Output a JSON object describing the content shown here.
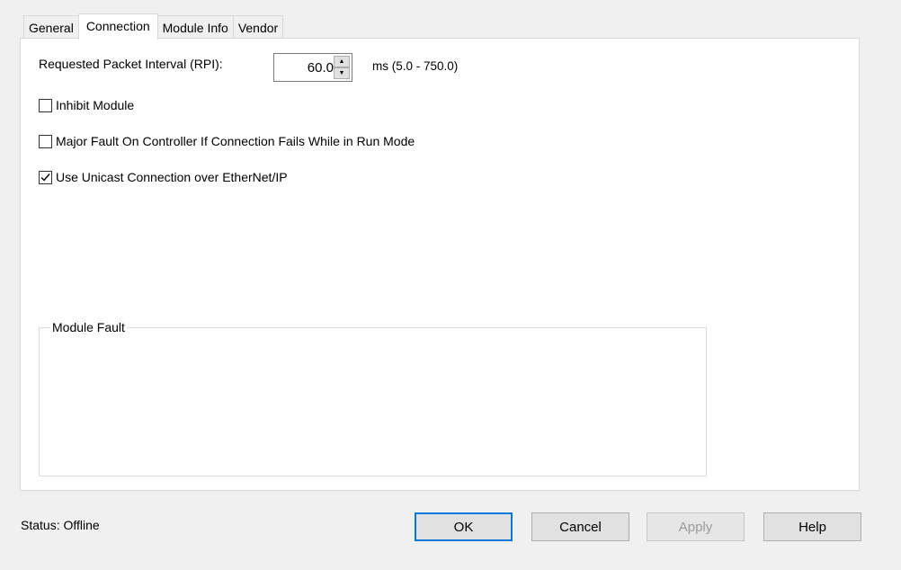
{
  "tabs": [
    {
      "label": "General",
      "active": false
    },
    {
      "label": "Connection",
      "active": true
    },
    {
      "label": "Module Info",
      "active": false
    },
    {
      "label": "Vendor",
      "active": false
    }
  ],
  "rpi": {
    "label": "Requested Packet Interval (RPI):",
    "value": "60.0",
    "range": "ms (5.0 - 750.0)"
  },
  "options": {
    "inhibit": {
      "label": "Inhibit Module",
      "checked": false
    },
    "major_fault": {
      "label": "Major Fault On Controller If Connection Fails While in Run Mode",
      "checked": false
    },
    "unicast": {
      "label": "Use Unicast Connection over EtherNet/IP",
      "checked": true
    }
  },
  "module_fault": {
    "title": "Module Fault"
  },
  "status": {
    "text": "Status:  Offline"
  },
  "buttons": {
    "ok": "OK",
    "cancel": "Cancel",
    "apply": "Apply",
    "help": "Help"
  },
  "icons": {
    "spin_up": "arrow-up-icon",
    "spin_down": "arrow-down-icon",
    "check": "checkmark-icon"
  }
}
